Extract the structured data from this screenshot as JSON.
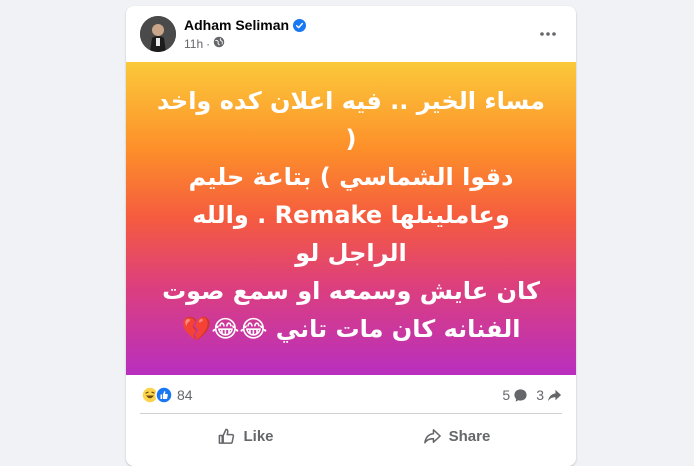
{
  "post": {
    "author": "Adham Seliman",
    "time": "11h",
    "text_lines": [
      "مساء الخير .. فيه اعلان كده واخد (",
      "دقوا الشماسي ) بتاعة حليم",
      "وعاملينلها Remake . والله الراجل لو",
      "كان عايش وسمعه او سمع صوت",
      "الفنانه كان مات تاني 😂😂💔"
    ],
    "background": {
      "gradient_top": "#fbc93a",
      "gradient_bottom": "#b82fbf"
    }
  },
  "reactions": {
    "count": "84",
    "comments": "5",
    "shares": "3"
  },
  "actions": {
    "like_label": "Like",
    "share_label": "Share"
  },
  "icons": {
    "verified": "verified-badge-icon",
    "privacy": "globe-icon",
    "more": "more-options-icon",
    "haha": "haha-reaction-icon",
    "like": "like-reaction-icon",
    "comment": "comment-icon",
    "share": "share-icon"
  },
  "colors": {
    "brand_blue": "#1877f2",
    "text_secondary": "#65676b"
  }
}
